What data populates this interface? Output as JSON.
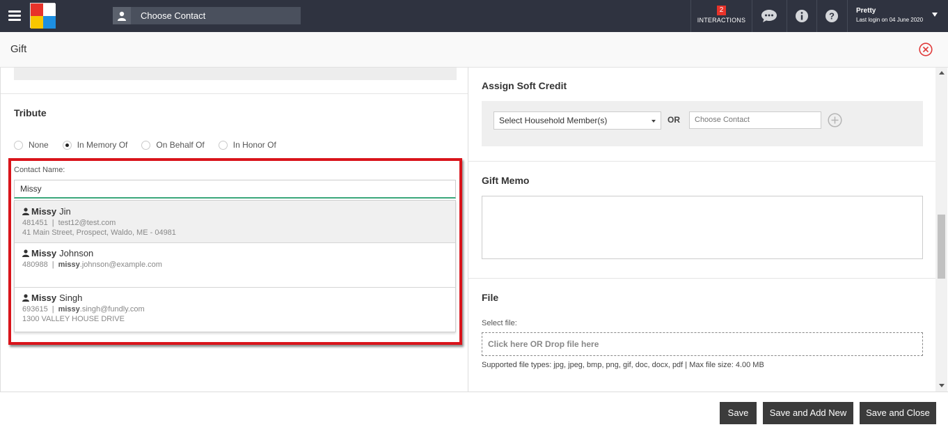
{
  "topbar": {
    "contact_placeholder": "Choose Contact",
    "interactions_count": "2",
    "interactions_label": "INTERACTIONS",
    "user_name": "Pretty",
    "last_login": "Last login on 04 June 2020"
  },
  "header": {
    "title": "Gift"
  },
  "tribute": {
    "title": "Tribute",
    "options": [
      "None",
      "In Memory Of",
      "On Behalf Of",
      "In Honor Of"
    ],
    "selected": "In Memory Of",
    "contact_label": "Contact Name:",
    "contact_value": "Missy",
    "results": [
      {
        "first": "Missy",
        "last": "Jin",
        "id": "481451",
        "email_prefix": "",
        "email_rest": "test12@test.com",
        "address": "41 Main Street, Prospect, Waldo, ME - 04981"
      },
      {
        "first": "Missy",
        "last": "Johnson",
        "id": "480988",
        "email_prefix": "missy",
        "email_rest": ".johnson@example.com",
        "address": ""
      },
      {
        "first": "Missy",
        "last": "Singh",
        "id": "693615",
        "email_prefix": "missy",
        "email_rest": ".singh@fundly.com",
        "address": "1300 VALLEY HOUSE DRIVE"
      }
    ]
  },
  "soft_credit": {
    "title": "Assign Soft Credit",
    "household_select": "Select Household Member(s)",
    "or": "OR",
    "contact_placeholder": "Choose Contact"
  },
  "memo": {
    "title": "Gift Memo",
    "value": ""
  },
  "file": {
    "title": "File",
    "select_label": "Select file:",
    "drop_text": "Click here OR Drop file here",
    "supported": "Supported file types: jpg, jpeg, bmp, png, gif, doc, docx, pdf | Max file size: 4.00 MB"
  },
  "footer": {
    "save": "Save",
    "save_add": "Save and Add New",
    "save_close": "Save and Close"
  },
  "colors": {
    "topbar": "#2f3340",
    "accent_red": "#d9141b",
    "input_focus": "#3aa67a",
    "button": "#3b3b3b"
  }
}
